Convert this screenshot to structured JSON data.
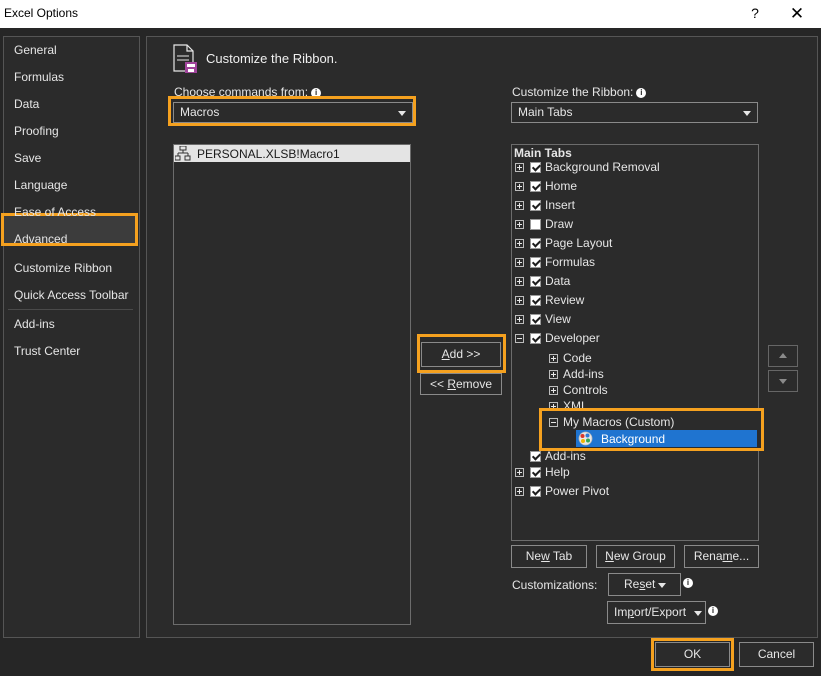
{
  "window": {
    "title": "Excel Options",
    "help_glyph": "?",
    "close_glyph": "✕"
  },
  "nav": {
    "items": [
      {
        "label": "General"
      },
      {
        "label": "Formulas"
      },
      {
        "label": "Data"
      },
      {
        "label": "Proofing"
      },
      {
        "label": "Save"
      },
      {
        "label": "Language"
      },
      {
        "label": "Ease of Access"
      },
      {
        "label": "Advanced"
      },
      {
        "label": "Customize Ribbon"
      },
      {
        "label": "Quick Access Toolbar"
      },
      {
        "label": "Add-ins"
      },
      {
        "label": "Trust Center"
      }
    ],
    "selected": "Customize Ribbon"
  },
  "main": {
    "heading": "Customize the Ribbon.",
    "left": {
      "label": "Choose commands from:",
      "selected": "Macros",
      "items": [
        {
          "label": "PERSONAL.XLSB!Macro1"
        }
      ]
    },
    "right": {
      "label": "Customize the Ribbon:",
      "selected": "Main Tabs",
      "header": "Main Tabs",
      "tree": [
        {
          "label": "Background Removal",
          "checked": true,
          "expanded": false
        },
        {
          "label": "Home",
          "checked": true,
          "expanded": false
        },
        {
          "label": "Insert",
          "checked": true,
          "expanded": false
        },
        {
          "label": "Draw",
          "checked": false,
          "expanded": false
        },
        {
          "label": "Page Layout",
          "checked": true,
          "expanded": false
        },
        {
          "label": "Formulas",
          "checked": true,
          "expanded": false
        },
        {
          "label": "Data",
          "checked": true,
          "expanded": false
        },
        {
          "label": "Review",
          "checked": true,
          "expanded": false
        },
        {
          "label": "View",
          "checked": true,
          "expanded": false
        },
        {
          "label": "Developer",
          "checked": true,
          "expanded": true,
          "children": [
            "Code",
            "Add-ins",
            "Controls",
            "XML"
          ],
          "custom_group": {
            "label": "My Macros (Custom)",
            "item": "Background"
          }
        },
        {
          "label": "Add-ins",
          "checked": true,
          "expanded": false
        },
        {
          "label": "Help",
          "checked": true,
          "expanded": false
        },
        {
          "label": "Power Pivot",
          "checked": true,
          "expanded": false
        }
      ]
    },
    "buttons": {
      "add_prefix": "A",
      "add_rest": "dd >>",
      "remove_prefix": "<< ",
      "remove_accel": "R",
      "remove_rest": "emove",
      "new_tab_prefix": "Ne",
      "new_tab_accel": "w",
      "new_tab_rest": " Tab",
      "new_group_accel": "N",
      "new_group_rest": "ew Group",
      "rename_prefix": "Rena",
      "rename_accel": "m",
      "rename_rest": "e...",
      "reset_prefix": "Re",
      "reset_accel": "s",
      "reset_rest": "et",
      "import_prefix": "Im",
      "import_accel": "p",
      "import_rest": "ort/Export",
      "ok": "OK",
      "cancel": "Cancel"
    },
    "customizations_label": "Customizations:",
    "info_glyph": "i"
  },
  "colors": {
    "highlight": "#f5a11f",
    "selection": "#1f74d0",
    "background": "#262626"
  }
}
